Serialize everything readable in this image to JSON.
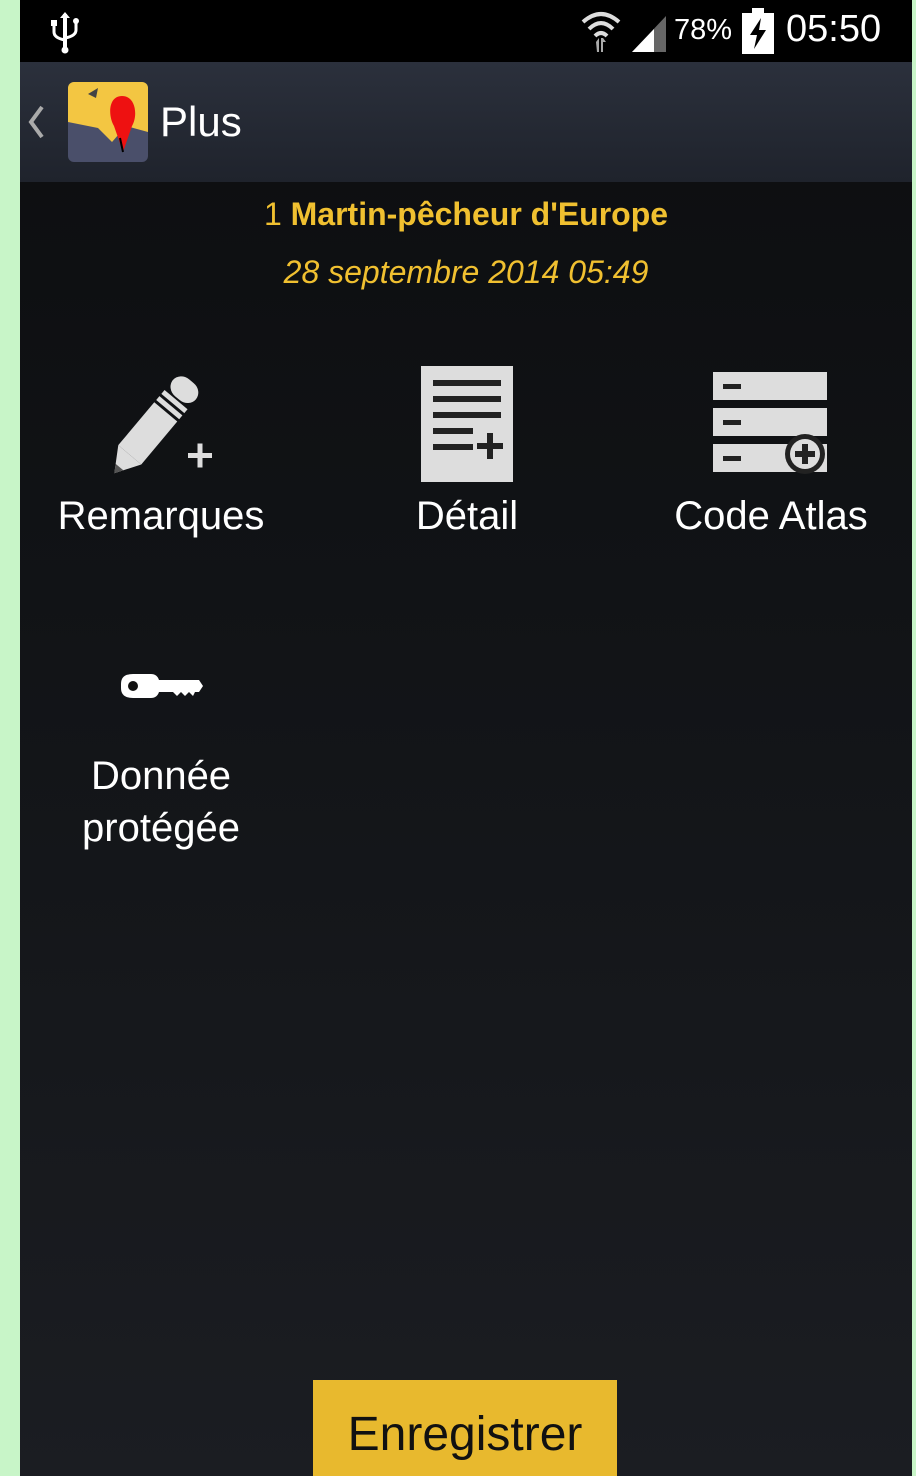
{
  "status_bar": {
    "battery_percent": "78%",
    "time": "05:50",
    "icons": [
      "usb-icon",
      "wifi-icon",
      "signal-icon",
      "battery-charging-icon"
    ]
  },
  "action_bar": {
    "title": "Plus",
    "back_icon": "chevron-left-icon",
    "logo_icon": "map-pin-logo-icon"
  },
  "observation": {
    "count": "1",
    "species": "Martin-pêcheur d'Europe",
    "datetime": "28 septembre 2014 05:49"
  },
  "tiles": [
    {
      "label": "Remarques",
      "icon": "pencil-plus-icon"
    },
    {
      "label": "Détail",
      "icon": "document-plus-icon"
    },
    {
      "label": "Code Atlas",
      "icon": "list-plus-icon"
    },
    {
      "label_line1": "Donnée",
      "label_line2": "protégée",
      "icon": "key-icon"
    }
  ],
  "save_button": {
    "label": "Enregistrer"
  },
  "colors": {
    "accent": "#f0c030",
    "button": "#e8b92e",
    "background": "#111316",
    "action_bar": "#2b303c",
    "outer_frame": "#c8f5c8"
  }
}
